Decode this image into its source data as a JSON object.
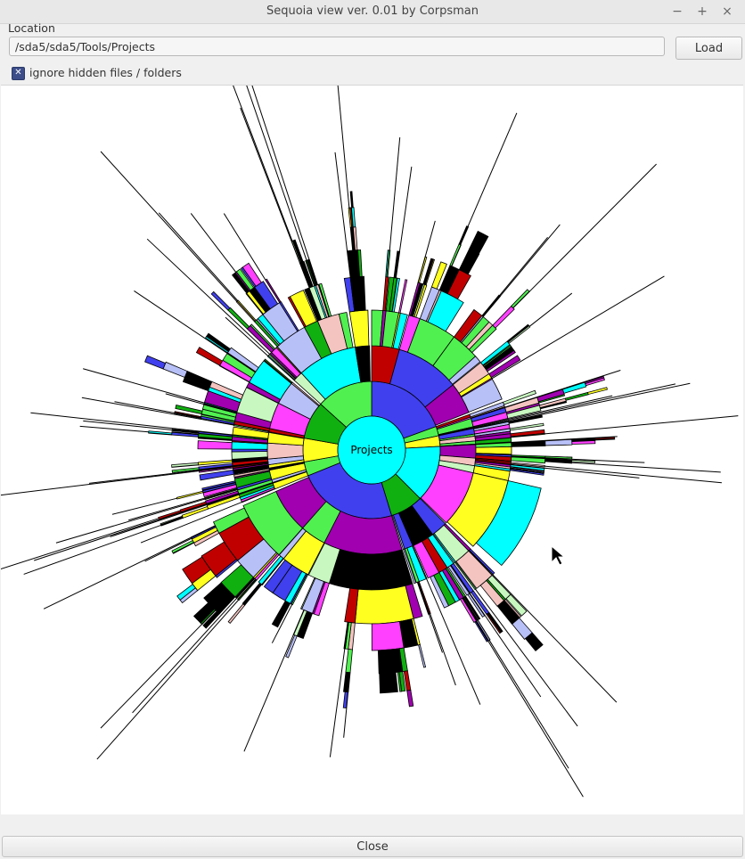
{
  "window": {
    "title": "Sequoia view ver. 0.01 by Corpsman",
    "minimize": "−",
    "maximize": "+",
    "close": "×"
  },
  "location": {
    "label": "Location",
    "value": "/sda5/sda5/Tools/Projects",
    "load_label": "Load"
  },
  "options": {
    "ignore_hidden_label": "ignore hidden files / folders",
    "ignore_hidden_checked": true,
    "check_glyph": "✕"
  },
  "sunburst": {
    "center_label": "Projects",
    "center_color": "#00ffff",
    "palette": [
      "#4040ee",
      "#a000b0",
      "#f4c4c0",
      "#c8f8c0",
      "#10b010",
      "#ff40ff",
      "#00ffff",
      "#b8c0f8",
      "#ffff20",
      "#50f050",
      "#c00000",
      "#000000"
    ],
    "ring1": [
      {
        "sweep": 70,
        "color": "#4040ee"
      },
      {
        "sweep": 8,
        "color": "#50f050"
      },
      {
        "sweep": 9,
        "color": "#ffff20"
      },
      {
        "sweep": 48,
        "color": "#00ffff"
      },
      {
        "sweep": 28,
        "color": "#10b010"
      },
      {
        "sweep": 85,
        "color": "#4040ee"
      },
      {
        "sweep": 12,
        "color": "#50f050"
      },
      {
        "sweep": 20,
        "color": "#ffff20"
      },
      {
        "sweep": 32,
        "color": "#10b010"
      },
      {
        "sweep": 48,
        "color": "#50f050"
      }
    ]
  },
  "footer": {
    "close_label": "Close"
  }
}
